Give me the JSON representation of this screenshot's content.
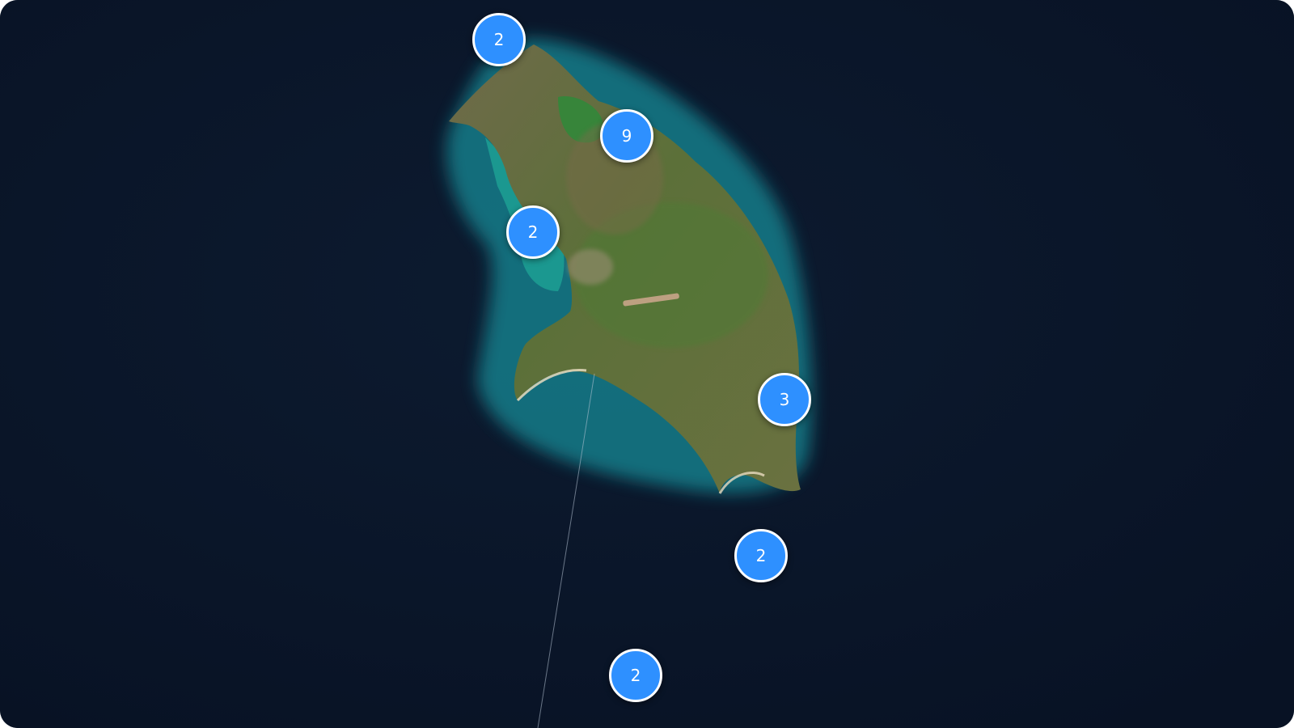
{
  "map": {
    "style": "satellite",
    "clusters": [
      {
        "id": "cluster-a",
        "count": "2"
      },
      {
        "id": "cluster-b",
        "count": "9"
      },
      {
        "id": "cluster-c",
        "count": "2"
      },
      {
        "id": "cluster-d",
        "count": "3"
      },
      {
        "id": "cluster-e",
        "count": "2"
      },
      {
        "id": "cluster-f",
        "count": "2"
      }
    ],
    "colors": {
      "ocean": "#0a1428",
      "marker_fill": "#2e90ff",
      "marker_border": "#ffffff",
      "land": "#5b6e3a",
      "shallow_water": "#1fa0a8"
    }
  }
}
